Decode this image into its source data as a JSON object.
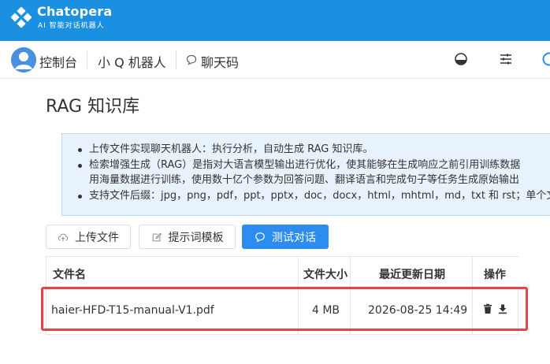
{
  "brand": {
    "name": "Chatopera",
    "subtitle": "AI 智能对话机器人"
  },
  "nav": {
    "console": "控制台",
    "bot": "小 Q 机器人",
    "chat_code": "聊天码"
  },
  "page": {
    "title": "RAG 知识库"
  },
  "info": {
    "items": [
      "上传文件实现聊天机器人：执行分析，自动生成 RAG 知识库。",
      "检索增强生成（RAG）是指对大语言模型输出进行优化，使其能够在生成响应之前引用训练数据",
      "用海量数据进行训练，使用数十亿个参数为回答问题、翻译语言和完成句子等任务生成原始输出",
      "支持文件后缀：jpg，png，pdf，ppt，pptx，doc，docx，html，mhtml，md，txt 和 rst；单个文"
    ]
  },
  "toolbar": {
    "upload": "上传文件",
    "prompt_template": "提示词模板",
    "test_chat": "测试对话"
  },
  "table": {
    "headers": {
      "name": "文件名",
      "size": "文件大小",
      "updated": "最近更新日期",
      "actions": "操作"
    },
    "rows": [
      {
        "name": "haier-HFD-T15-manual-V1.pdf",
        "size": "4 MB",
        "updated": "2026-08-25 14:49"
      }
    ]
  },
  "colors": {
    "brand": "#1b8fe0",
    "primary": "#2d8cf0",
    "highlight": "#e34449",
    "info_bg": "#e8f2fc"
  }
}
